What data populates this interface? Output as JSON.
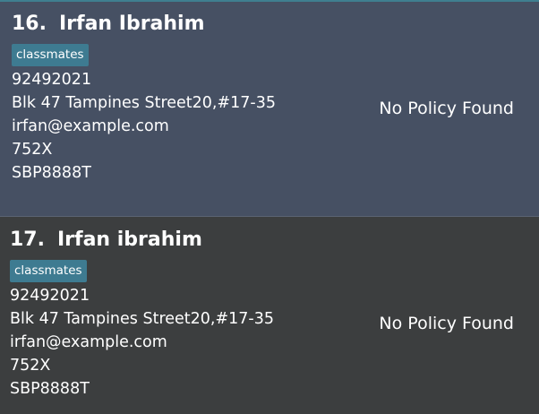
{
  "persons": [
    {
      "index": "16.",
      "name": "Irfan Ibrahim",
      "tags": [
        "classmates"
      ],
      "phone": "92492021",
      "address": "Blk 47 Tampines Street20,#17-35",
      "email": "irfan@example.com",
      "postal": "752X",
      "vehicle": "SBP8888T",
      "policy_status": "No Policy Found"
    },
    {
      "index": "17.",
      "name": "Irfan ibrahim",
      "tags": [
        "classmates"
      ],
      "phone": "92492021",
      "address": "Blk 47 Tampines Street20,#17-35",
      "email": "irfan@example.com",
      "postal": "752X",
      "vehicle": "SBP8888T",
      "policy_status": "No Policy Found"
    }
  ],
  "colors": {
    "selected_card_bg": "#465063",
    "card_bg": "#3c3e3f",
    "tag_bg": "#3e7b91",
    "text": "#ffffff"
  }
}
